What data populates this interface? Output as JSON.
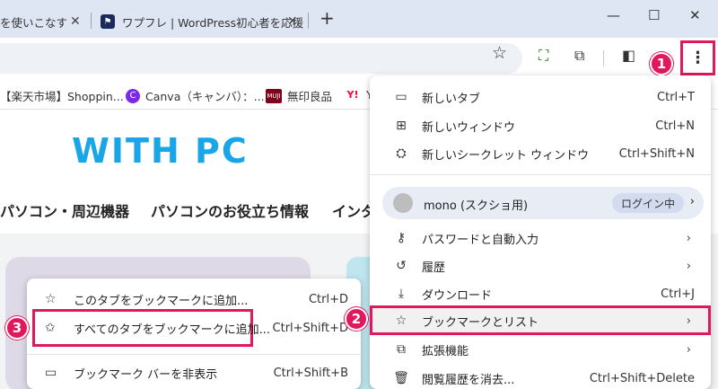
{
  "browser": {
    "tabs": [
      {
        "title": "を使いこなす"
      },
      {
        "title": "ワプフレ | WordPress初心者を応援"
      }
    ],
    "new_tab_label": "+",
    "window_controls": {
      "minimize": "—",
      "maximize": "☐",
      "close": "✕"
    },
    "badges": {
      "menu": "1",
      "bookmarks_list": "2",
      "bookmark_all": "3"
    }
  },
  "bookmarks_bar": [
    {
      "label": "【楽天市場】Shoppin...",
      "icon": "rakuten-icon"
    },
    {
      "label": "Canva（キャンバ）：...",
      "icon": "canva-icon"
    },
    {
      "label": "無印良品",
      "icon": "muji-icon",
      "icon_text": "MUJI"
    },
    {
      "label": "Y",
      "icon": "yahoo-icon",
      "icon_text": "Y!"
    }
  ],
  "page": {
    "logo": "WITH PC",
    "nav": [
      "パソコン・周辺機器",
      "パソコンのお役立ち情報",
      "インタ"
    ]
  },
  "menu": {
    "items_top": [
      {
        "label": "新しいタブ",
        "shortcut": "Ctrl+T",
        "icon": "new-tab-icon"
      },
      {
        "label": "新しいウィンドウ",
        "shortcut": "Ctrl+N",
        "icon": "new-window-icon"
      },
      {
        "label": "新しいシークレット ウィンドウ",
        "shortcut": "Ctrl+Shift+N",
        "icon": "incognito-icon"
      }
    ],
    "profile": {
      "name": "mono (スクショ用)",
      "status": "ログイン中"
    },
    "items_mid": [
      {
        "label": "パスワードと自動入力",
        "icon": "key-icon"
      },
      {
        "label": "履歴",
        "icon": "history-icon"
      },
      {
        "label": "ダウンロード",
        "shortcut": "Ctrl+J",
        "icon": "download-icon"
      },
      {
        "label": "ブックマークとリスト",
        "icon": "star-icon"
      },
      {
        "label": "拡張機能",
        "icon": "extension-icon"
      },
      {
        "label": "閲覧履歴を消去...",
        "shortcut": "Ctrl+Shift+Delete",
        "icon": "trash-icon"
      }
    ]
  },
  "submenu": {
    "items": [
      {
        "label": "このタブをブックマークに追加...",
        "shortcut": "Ctrl+D",
        "icon": "star-outline-icon"
      },
      {
        "label": "すべてのタブをブックマークに追加...",
        "shortcut": "Ctrl+Shift+D",
        "icon": "star-multi-icon"
      },
      {
        "label": "ブックマーク バーを非表示",
        "shortcut": "Ctrl+Shift+B",
        "icon": "bookmark-bar-icon"
      }
    ]
  },
  "colors": {
    "accent": "#e0185c",
    "logo": "#1aa6e6",
    "tabstrip": "#dfe6f3"
  }
}
